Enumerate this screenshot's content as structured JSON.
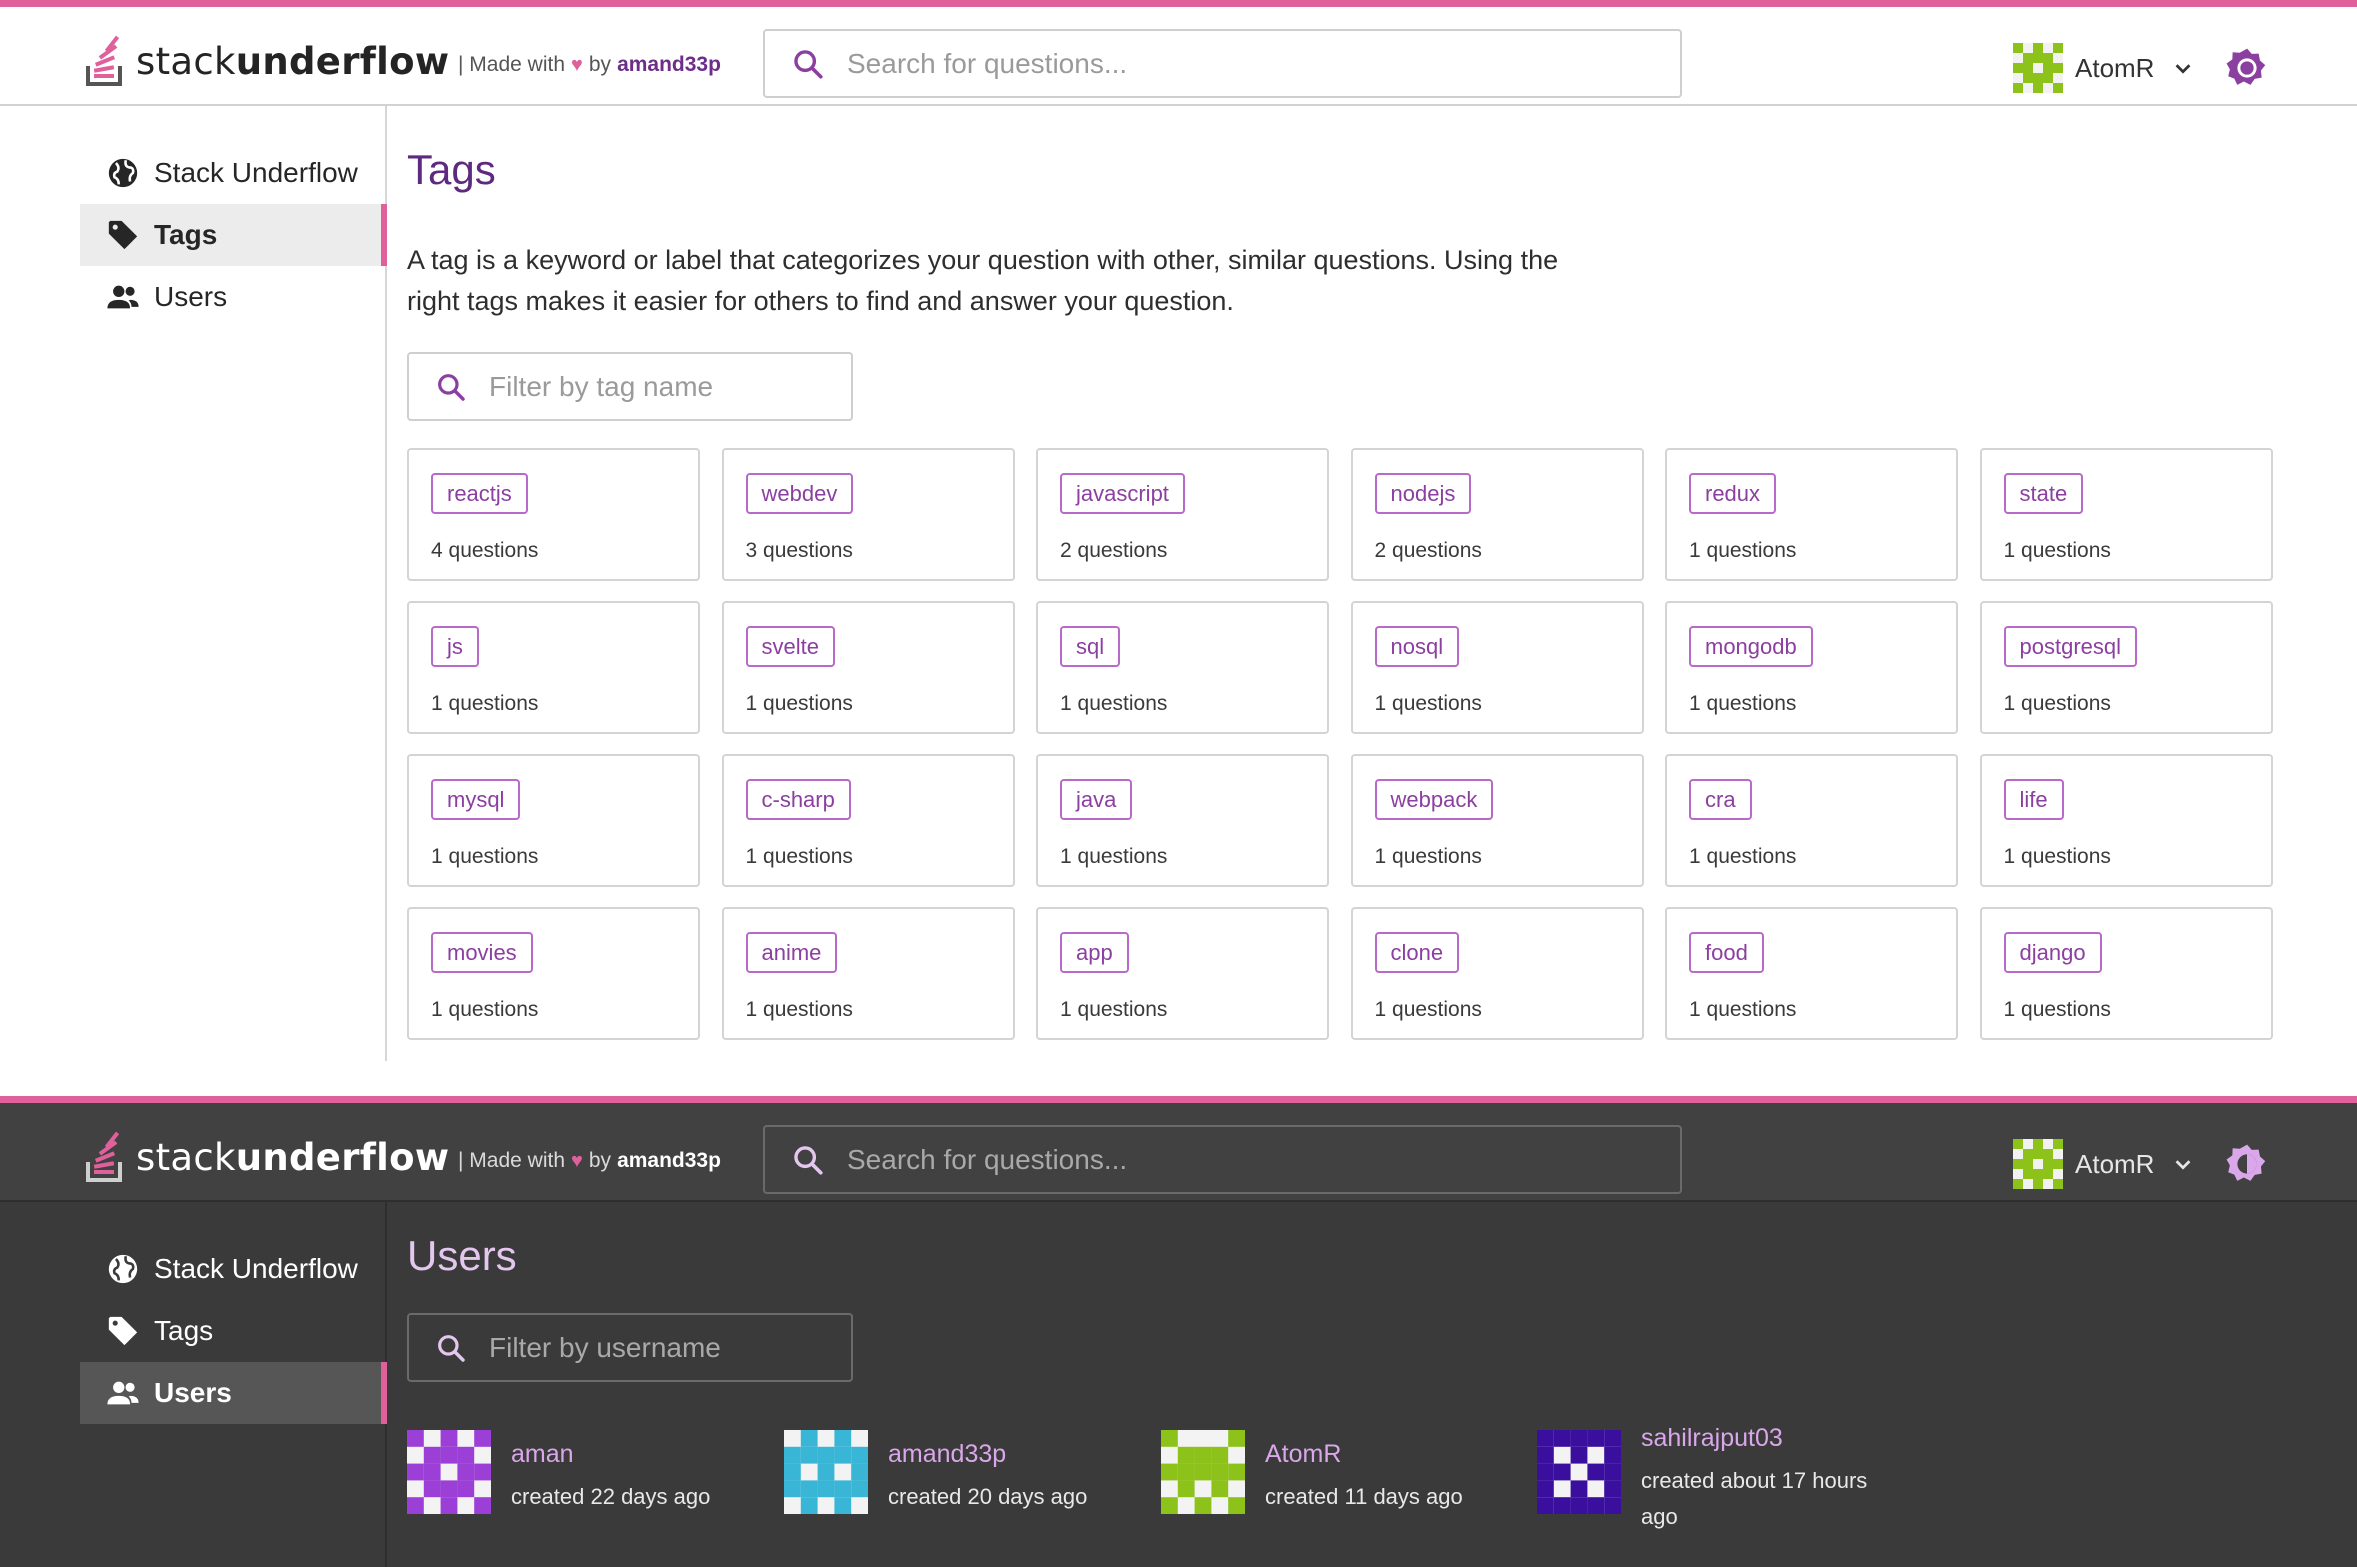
{
  "brand": {
    "name_light": "stack",
    "name_bold": "underflow",
    "made_prefix": "| Made with",
    "made_by": "by",
    "author": "amand33p"
  },
  "header": {
    "search_placeholder": "Search for questions...",
    "username": "AtomR"
  },
  "sidebar": {
    "items": [
      {
        "label": "Stack Underflow",
        "icon": "globe-icon"
      },
      {
        "label": "Tags",
        "icon": "tag-icon"
      },
      {
        "label": "Users",
        "icon": "users-icon"
      }
    ]
  },
  "tags_page": {
    "title": "Tags",
    "description": "A tag is a keyword or label that categorizes your question with other, similar questions. Using the right tags makes it easier for others to find and answer your question.",
    "filter_placeholder": "Filter by tag name",
    "tags": [
      {
        "name": "reactjs",
        "count": "4 questions"
      },
      {
        "name": "webdev",
        "count": "3 questions"
      },
      {
        "name": "javascript",
        "count": "2 questions"
      },
      {
        "name": "nodejs",
        "count": "2 questions"
      },
      {
        "name": "redux",
        "count": "1 questions"
      },
      {
        "name": "state",
        "count": "1 questions"
      },
      {
        "name": "js",
        "count": "1 questions"
      },
      {
        "name": "svelte",
        "count": "1 questions"
      },
      {
        "name": "sql",
        "count": "1 questions"
      },
      {
        "name": "nosql",
        "count": "1 questions"
      },
      {
        "name": "mongodb",
        "count": "1 questions"
      },
      {
        "name": "postgresql",
        "count": "1 questions"
      },
      {
        "name": "mysql",
        "count": "1 questions"
      },
      {
        "name": "c-sharp",
        "count": "1 questions"
      },
      {
        "name": "java",
        "count": "1 questions"
      },
      {
        "name": "webpack",
        "count": "1 questions"
      },
      {
        "name": "cra",
        "count": "1 questions"
      },
      {
        "name": "life",
        "count": "1 questions"
      },
      {
        "name": "movies",
        "count": "1 questions"
      },
      {
        "name": "anime",
        "count": "1 questions"
      },
      {
        "name": "app",
        "count": "1 questions"
      },
      {
        "name": "clone",
        "count": "1 questions"
      },
      {
        "name": "food",
        "count": "1 questions"
      },
      {
        "name": "django",
        "count": "1 questions"
      }
    ]
  },
  "users_page": {
    "title": "Users",
    "filter_placeholder": "Filter by username",
    "users": [
      {
        "username": "aman",
        "created": "created 22 days ago",
        "avatar_color": "#9b3fd6"
      },
      {
        "username": "amand33p",
        "created": "created 20 days ago",
        "avatar_color": "#39b6d6"
      },
      {
        "username": "AtomR",
        "created": "created 11 days ago",
        "avatar_color": "#8cc21a"
      },
      {
        "username": "sahilrajput03",
        "created": "created about 17 hours ago",
        "avatar_color": "#3a0f9e"
      }
    ]
  },
  "colors": {
    "accent_pink": "#e0609b",
    "purple": "#8b3fa0",
    "title_purple": "#5e2a80",
    "dark_bg": "#3a3a3a"
  }
}
